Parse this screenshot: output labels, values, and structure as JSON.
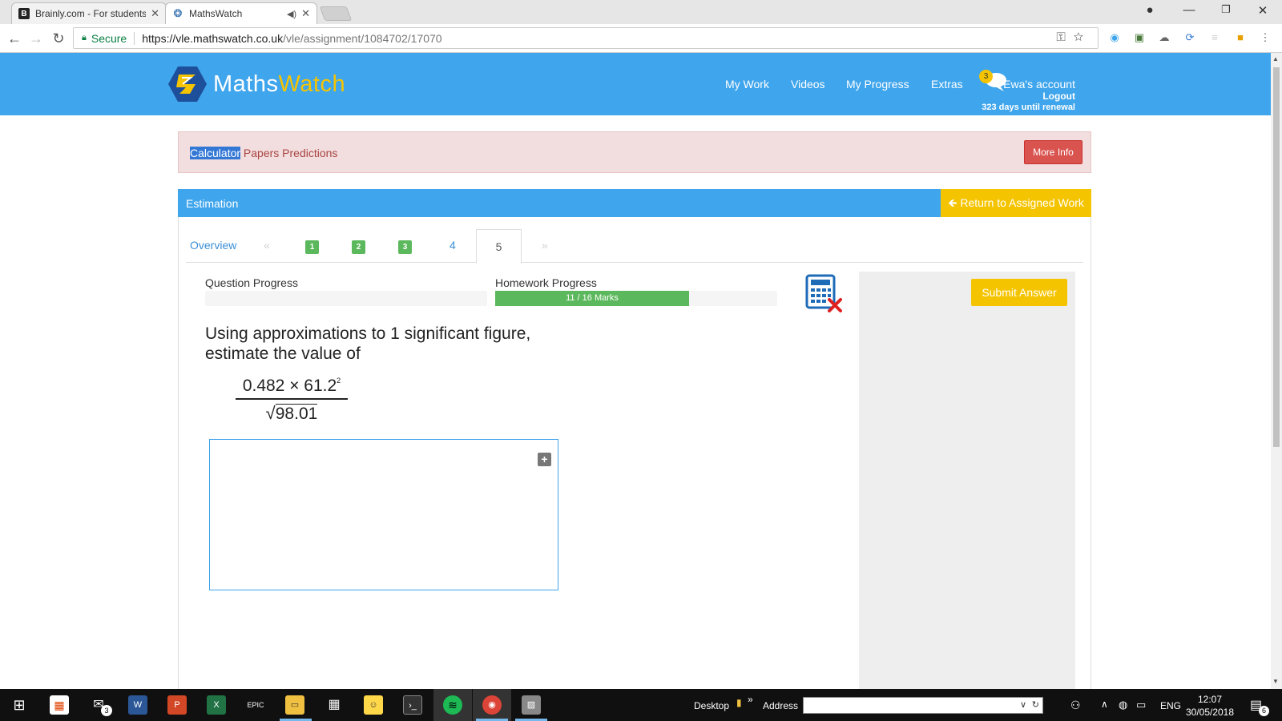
{
  "browser": {
    "tabs": [
      {
        "title": "Brainly.com - For students",
        "favicon": "brainly-icon"
      },
      {
        "title": "MathsWatch",
        "favicon": "mathswatch-icon"
      }
    ],
    "address": {
      "secure_label": "Secure",
      "url_host": "https://vle.mathswatch.co.uk",
      "url_path": "/vle/assignment/1084702/17070"
    }
  },
  "site": {
    "logo": {
      "part1": "Maths",
      "part2": "Watch"
    },
    "nav": [
      "My Work",
      "Videos",
      "My Progress",
      "Extras"
    ],
    "chat_badge": "3",
    "account": {
      "name": "Ewa's account",
      "logout": "Logout",
      "renewal": "323 days until renewal"
    }
  },
  "banner": {
    "highlighted": "Calculator",
    "text": " Papers Predictions",
    "button": "More Info"
  },
  "panel": {
    "title": "Estimation",
    "return_label": "Return to Assigned Work"
  },
  "question_tabs": {
    "overview": "Overview",
    "prev": "«",
    "next": "»",
    "completed": [
      "1",
      "2",
      "3"
    ],
    "pending": "4",
    "active": "5"
  },
  "progress": {
    "question_label": "Question Progress",
    "question_value": 0,
    "homework_label": "Homework Progress",
    "homework_text": "11 / 16 Marks",
    "homework_marks": 11,
    "homework_total": 16
  },
  "question": {
    "line1": "Using approximations to 1 significant figure,",
    "line2": "estimate the value of",
    "numerator": "0.482 × 61.2",
    "exponent": "2",
    "denominator": "98.01"
  },
  "side": {
    "submit_label": "Submit Answer"
  },
  "taskbar": {
    "desktop_label": "Desktop",
    "address_label": "Address",
    "mail_badge": "3",
    "lang": "ENG",
    "time": "12:07",
    "date": "30/05/2018",
    "notifications": "6"
  },
  "colors": {
    "brand_blue": "#3fa5ec",
    "brand_yellow": "#f5c400",
    "success_green": "#5cb85c",
    "danger_red": "#d9534f"
  }
}
